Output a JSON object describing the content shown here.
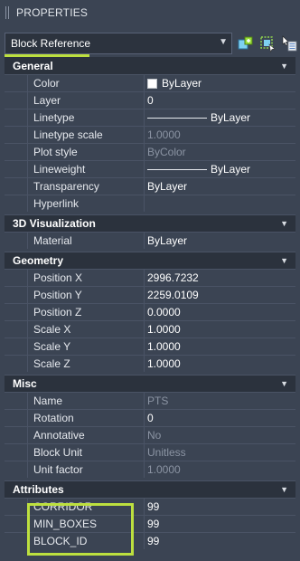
{
  "panel": {
    "title": "PROPERTIES"
  },
  "selector": {
    "value": "Block Reference"
  },
  "tools": [
    "quick-select-icon",
    "select-objects-icon",
    "toggle-pickadd-icon"
  ],
  "categories": {
    "general": {
      "title": "General",
      "rows": [
        {
          "label": "Color",
          "value": "ByLayer"
        },
        {
          "label": "Layer",
          "value": "0"
        },
        {
          "label": "Linetype",
          "value": "ByLayer"
        },
        {
          "label": "Linetype scale",
          "value": "1.0000"
        },
        {
          "label": "Plot style",
          "value": "ByColor"
        },
        {
          "label": "Lineweight",
          "value": "ByLayer"
        },
        {
          "label": "Transparency",
          "value": "ByLayer"
        },
        {
          "label": "Hyperlink",
          "value": ""
        }
      ]
    },
    "viz3d": {
      "title": "3D Visualization",
      "rows": [
        {
          "label": "Material",
          "value": "ByLayer"
        }
      ]
    },
    "geometry": {
      "title": "Geometry",
      "rows": [
        {
          "label": "Position X",
          "value": "2996.7232"
        },
        {
          "label": "Position Y",
          "value": "2259.0109"
        },
        {
          "label": "Position Z",
          "value": "0.0000"
        },
        {
          "label": "Scale X",
          "value": "1.0000"
        },
        {
          "label": "Scale Y",
          "value": "1.0000"
        },
        {
          "label": "Scale Z",
          "value": "1.0000"
        }
      ]
    },
    "misc": {
      "title": "Misc",
      "rows": [
        {
          "label": "Name",
          "value": "PTS"
        },
        {
          "label": "Rotation",
          "value": "0"
        },
        {
          "label": "Annotative",
          "value": "No"
        },
        {
          "label": "Block Unit",
          "value": "Unitless"
        },
        {
          "label": "Unit factor",
          "value": "1.0000"
        }
      ]
    },
    "attributes": {
      "title": "Attributes",
      "rows": [
        {
          "label": "CORRIDOR",
          "value": "99"
        },
        {
          "label": "MIN_BOXES",
          "value": "99"
        },
        {
          "label": "BLOCK_ID",
          "value": "99"
        }
      ]
    }
  },
  "colors": {
    "accent": "#bde03f",
    "panel_bg": "#3b4453",
    "category_bg": "#2b323d"
  }
}
